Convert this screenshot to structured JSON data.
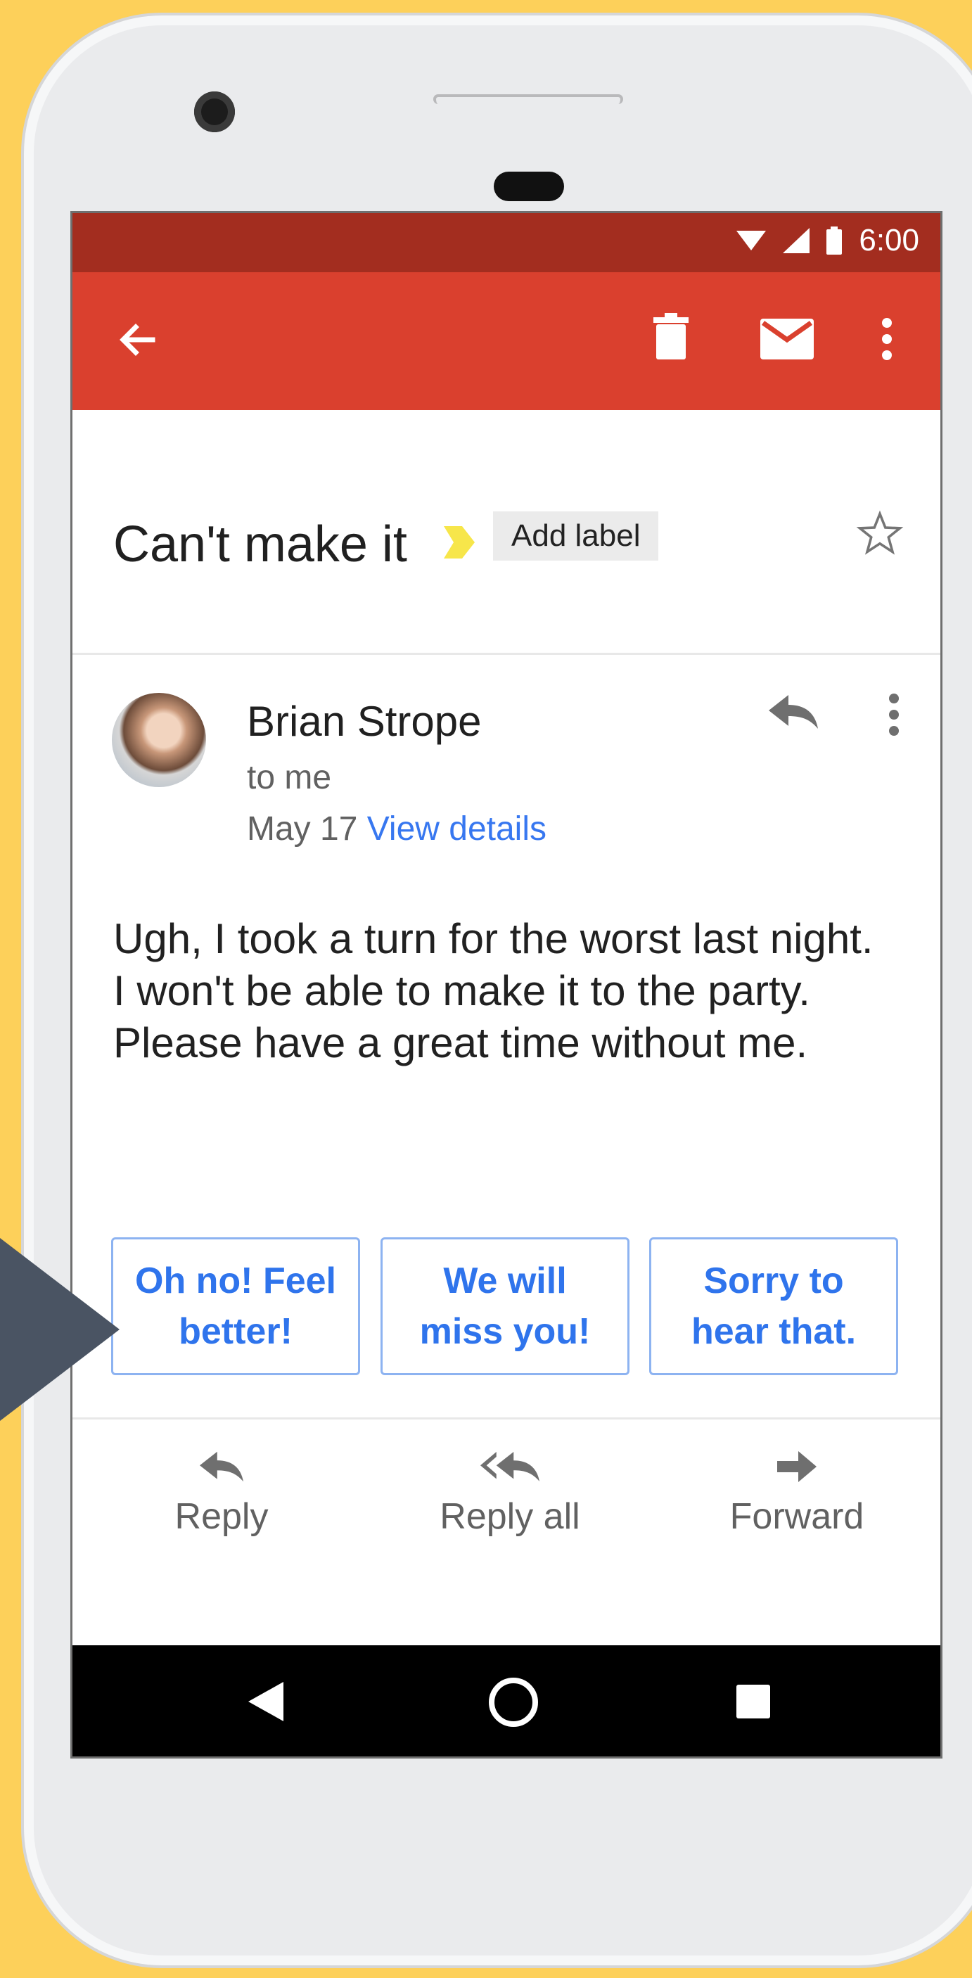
{
  "status_bar": {
    "time": "6:00"
  },
  "app_bar": {
    "icons": [
      "back-arrow-icon",
      "delete-icon",
      "mark-unread-icon",
      "more-vert-icon"
    ]
  },
  "email": {
    "subject": "Can't make it",
    "label_button": "Add label",
    "sender": "Brian Strope",
    "recipient": "to me",
    "date": "May 17",
    "details_link": "View details",
    "body": [
      "Ugh, I took a turn for the worst last night.",
      "I won't be able to make it to the party.",
      "Please have a great time without me."
    ]
  },
  "smart_replies": [
    {
      "line1": "Oh no! Feel",
      "line2": "better!"
    },
    {
      "line1": "We will",
      "line2": "miss you!"
    },
    {
      "line1": "Sorry to",
      "line2": "hear that."
    }
  ],
  "actions": {
    "reply": "Reply",
    "reply_all": "Reply all",
    "forward": "Forward"
  },
  "colors": {
    "background": "#fdd05a",
    "status_bar": "#a32d1f",
    "app_bar": "#da402e",
    "link": "#3777f0",
    "chip_text": "#2f74ec",
    "pointer": "#4a5463"
  }
}
